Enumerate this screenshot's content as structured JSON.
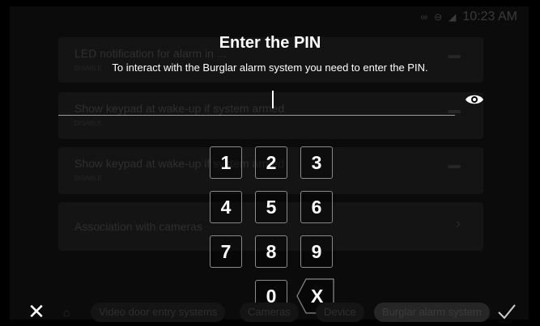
{
  "status_bar": {
    "icons": [
      "voicemail-icon",
      "dnd-icon",
      "no-signal-icon"
    ],
    "time": "10:23 AM"
  },
  "background_cards": [
    {
      "title": "LED notification for alarm in ...",
      "subtitle": "DISABLE",
      "control": "toggle"
    },
    {
      "title": "Show keypad at wake-up if system armed",
      "subtitle": "DISABLE",
      "control": "toggle"
    },
    {
      "title": "Show keypad at wake-up if system armed",
      "subtitle": "DISABLE",
      "control": "toggle"
    },
    {
      "title": "Association with cameras",
      "subtitle": "",
      "control": "chevron"
    }
  ],
  "dialog": {
    "title": "Enter the PIN",
    "subtitle": "To interact with the Burglar alarm system you need to enter the PIN.",
    "pin_value": "",
    "show_pin_icon": "eye-icon"
  },
  "keypad": {
    "keys": [
      "1",
      "2",
      "3",
      "4",
      "5",
      "6",
      "7",
      "8",
      "9",
      "0"
    ],
    "backspace_label": "X"
  },
  "bottom_bar": {
    "close_icon": "close-icon",
    "confirm_icon": "checkmark-icon",
    "tabs": [
      {
        "label": "Video door entry systems",
        "active": false
      },
      {
        "label": "Cameras",
        "active": false
      },
      {
        "label": "Device",
        "active": false
      },
      {
        "label": "Burglar alarm system",
        "active": true
      }
    ]
  },
  "colors": {
    "background": "#000000",
    "text": "#ffffff",
    "key_border": "#8a8a8a",
    "dimmed": "#141414"
  }
}
